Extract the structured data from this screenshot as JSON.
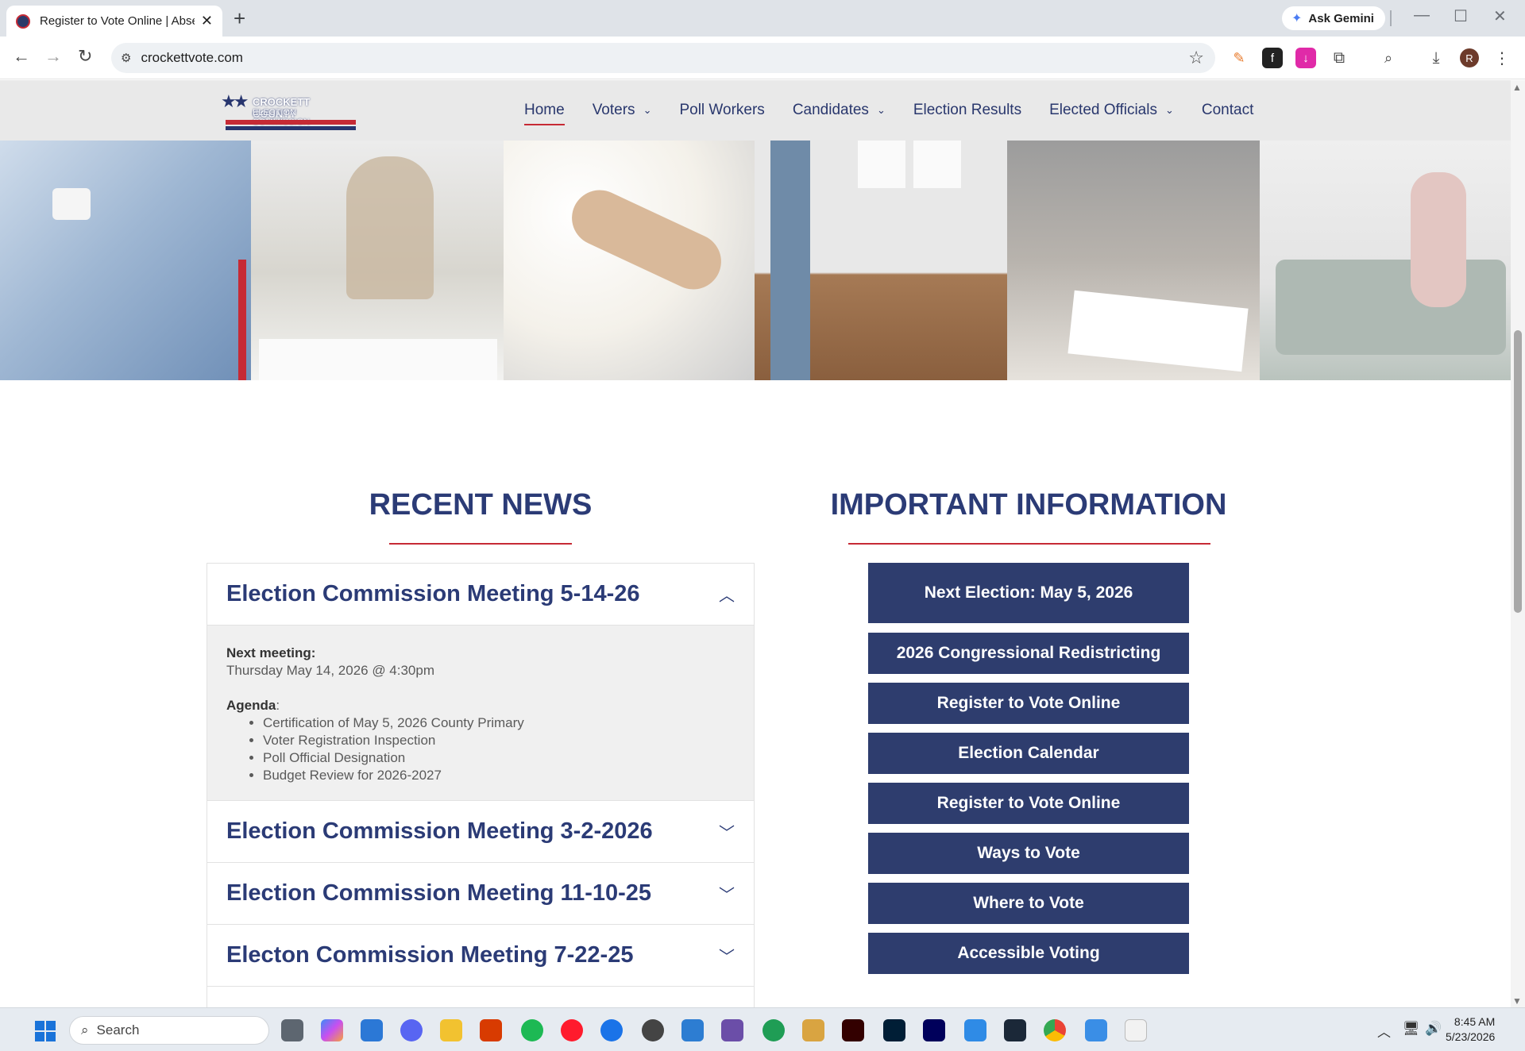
{
  "browser": {
    "tab_title": "Register to Vote Online | Absent",
    "new_tab": "+",
    "ask_gemini": "Ask Gemini",
    "url": "crockettvote.com",
    "profile_initial": "R"
  },
  "site": {
    "logo_line1": "CROCKETT COUNTY",
    "logo_line2": "ELECTION COMMISSION",
    "nav": [
      {
        "label": "Home",
        "dropdown": false,
        "active": true
      },
      {
        "label": "Voters",
        "dropdown": true
      },
      {
        "label": "Poll Workers",
        "dropdown": false
      },
      {
        "label": "Candidates",
        "dropdown": true
      },
      {
        "label": "Election Results",
        "dropdown": false
      },
      {
        "label": "Elected Officials",
        "dropdown": true
      },
      {
        "label": "Contact",
        "dropdown": false
      }
    ]
  },
  "news": {
    "title": "RECENT NEWS",
    "items": [
      {
        "title": "Election Commission Meeting 5-14-26",
        "expanded": true,
        "next_meeting_label": "Next meeting:",
        "next_meeting_value": "Thursday May 14, 2026 @ 4:30pm",
        "agenda_label": "Agenda",
        "agenda_colon": ":",
        "agenda": [
          "Certification of May 5, 2026 County Primary",
          "Voter Registration Inspection",
          "Poll Official Designation",
          "Budget Review for 2026-2027"
        ]
      },
      {
        "title": "Election Commission Meeting 3-2-2026",
        "expanded": false
      },
      {
        "title": "Election Commission Meeting 11-10-25",
        "expanded": false
      },
      {
        "title": "Electon Commission Meeting 7-22-25",
        "expanded": false
      }
    ]
  },
  "info": {
    "title": "IMPORTANT INFORMATION",
    "buttons": [
      "Next Election: May 5, 2026",
      "2026 Congressional Redistricting",
      "Register to Vote Online",
      "Election Calendar",
      "Register to Vote Online",
      "Ways to Vote",
      "Where to Vote",
      "Accessible Voting"
    ]
  },
  "taskbar": {
    "search_placeholder": "Search",
    "time": "8:45 AM",
    "date": "5/23/2026"
  },
  "colors": {
    "navy": "#2b3b76",
    "button": "#2e3d6e",
    "accent_red": "#c62a35"
  }
}
